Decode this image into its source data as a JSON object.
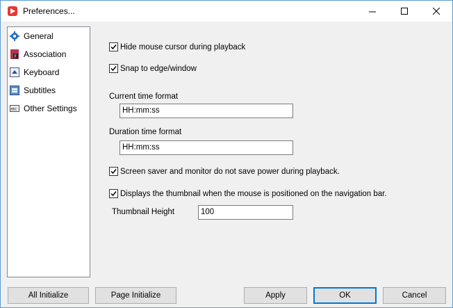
{
  "window": {
    "title": "Preferences..."
  },
  "sidebar": {
    "items": [
      {
        "label": "General",
        "icon": "gear-icon"
      },
      {
        "label": "Association",
        "icon": "file-association-icon"
      },
      {
        "label": "Keyboard",
        "icon": "keyboard-icon"
      },
      {
        "label": "Subtitles",
        "icon": "subtitles-icon"
      },
      {
        "label": "Other Settings",
        "icon": "etc-icon"
      }
    ]
  },
  "general": {
    "hide_cursor": {
      "label": "Hide mouse cursor during playback",
      "checked": true
    },
    "snap": {
      "label": "Snap to edge/window",
      "checked": true
    },
    "current_time_format": {
      "label": "Current time format",
      "value": "HH:mm:ss"
    },
    "duration_time_format": {
      "label": "Duration time format",
      "value": "HH:mm:ss"
    },
    "screensaver": {
      "label": "Screen saver and monitor do not save power during playback.",
      "checked": true
    },
    "thumbnail": {
      "label": "Displays the thumbnail when the mouse is positioned on the navigation bar.",
      "checked": true
    },
    "thumbnail_height": {
      "label": "Thumbnail Height",
      "value": "100"
    }
  },
  "buttons": {
    "all_initialize": "All Initialize",
    "page_initialize": "Page Initialize",
    "apply": "Apply",
    "ok": "OK",
    "cancel": "Cancel"
  },
  "colors": {
    "accent": "#0078d7",
    "app_icon": "#e53935"
  }
}
